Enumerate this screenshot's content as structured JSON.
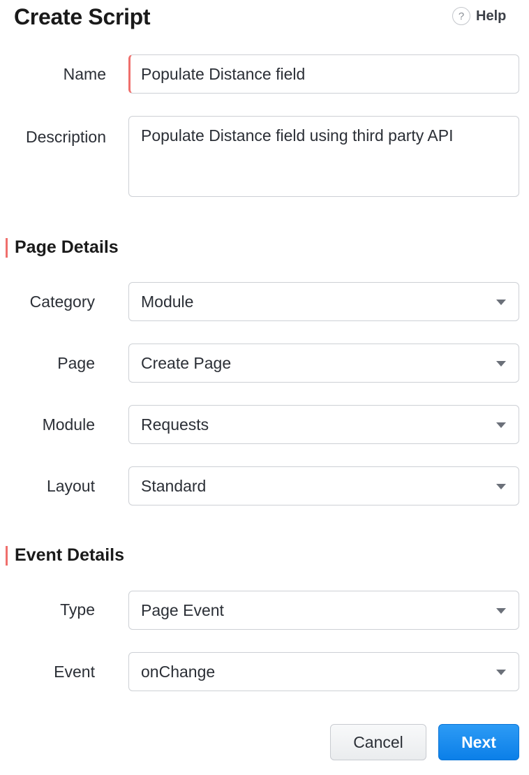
{
  "header": {
    "title": "Create Script",
    "help_label": "Help",
    "help_icon": "?"
  },
  "fields": {
    "name": {
      "label": "Name",
      "value": "Populate Distance field"
    },
    "description": {
      "label": "Description",
      "value": "Populate Distance field using third party API"
    }
  },
  "page_details": {
    "title": "Page Details",
    "category": {
      "label": "Category",
      "value": "Module"
    },
    "page": {
      "label": "Page",
      "value": "Create Page"
    },
    "module": {
      "label": "Module",
      "value": "Requests"
    },
    "layout": {
      "label": "Layout",
      "value": "Standard"
    }
  },
  "event_details": {
    "title": "Event Details",
    "type": {
      "label": "Type",
      "value": "Page Event"
    },
    "event": {
      "label": "Event",
      "value": "onChange"
    }
  },
  "actions": {
    "cancel_label": "Cancel",
    "next_label": "Next"
  },
  "colors": {
    "accent": "#ef6f6c",
    "primary": "#0b7fe8"
  }
}
